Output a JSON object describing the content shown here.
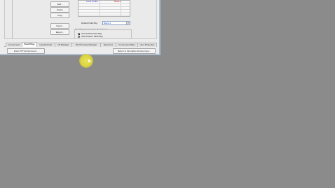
{
  "left_buttons": {
    "add": "Add...",
    "delete": "Delete",
    "copy": "Copy",
    "import": "Import...",
    "export": "Export..."
  },
  "grid": {
    "header_left": "Laser Aridiel",
    "header_right": "Basis-1"
  },
  "default_fluid_pkg": {
    "label": "Default Fluid Pkg",
    "value": "Basis-1"
  },
  "subflowsheet_group": {
    "title": "Fluid Pkg for New Sub-Flowsheets",
    "options": [
      "Use Default Fluid Pkg",
      "Use Parent's Fluid Pkg"
    ],
    "selected_index": 0
  },
  "tabs": [
    "Components",
    "Fluid Pkgs",
    "Hypotheticals",
    "Oil Manager",
    "RxnOil Assay Manager",
    "Reactions",
    "Component Maps",
    "User Properties"
  ],
  "active_tab_index": 1,
  "bottom_buttons": {
    "enter_pvt": "Enter PVT Environment...",
    "return_sim": "Return to Simulation Environment..."
  },
  "colors": {
    "desktop": "#8b8b8b",
    "window": "#ececec",
    "cursor_highlight": "#dcd43f"
  }
}
